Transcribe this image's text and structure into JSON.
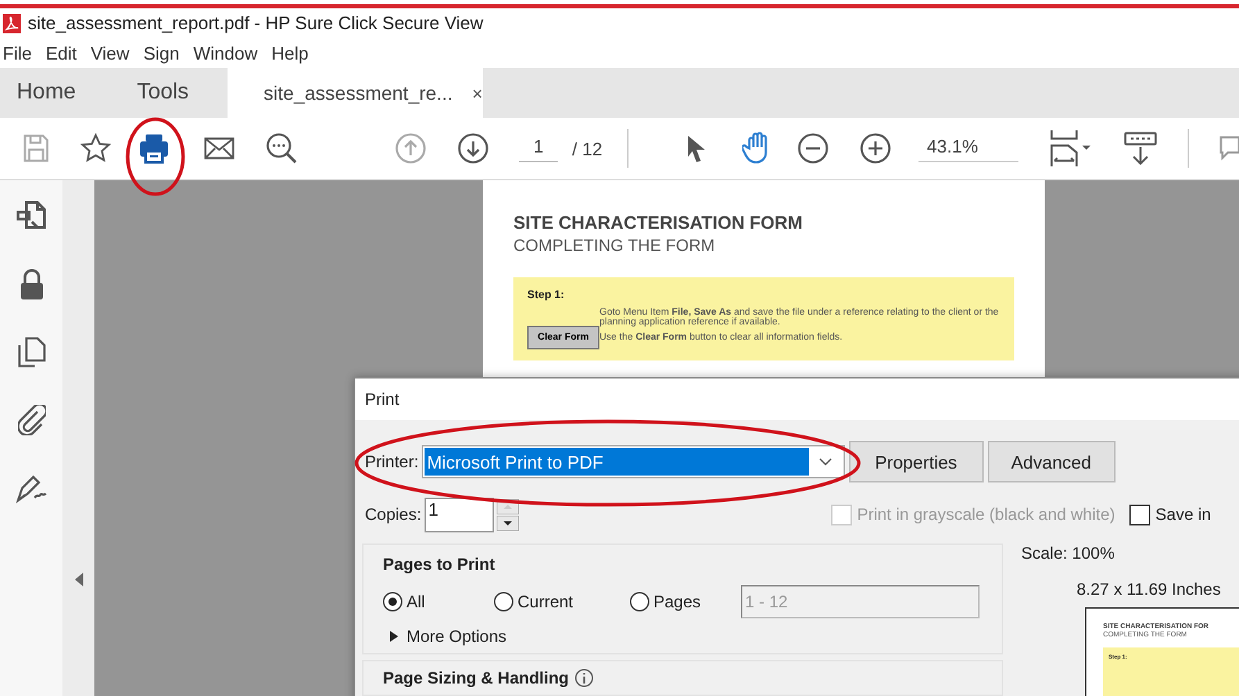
{
  "window": {
    "title": "site_assessment_report.pdf - HP Sure Click Secure View"
  },
  "menu": [
    "File",
    "Edit",
    "View",
    "Sign",
    "Window",
    "Help"
  ],
  "tabs": [
    {
      "label": "Home",
      "selected": false
    },
    {
      "label": "Tools",
      "selected": false
    },
    {
      "label": "site_assessment_re...",
      "selected": true,
      "close": "×"
    }
  ],
  "toolbar": {
    "page": "1",
    "page_total": "/ 12",
    "zoom": "43.1%",
    "tools": [
      {
        "kind": "select",
        "selected": false
      },
      {
        "kind": "hand",
        "selected": true
      }
    ]
  },
  "document": {
    "title": "SITE CHARACTERISATION FORM",
    "subtitle": "COMPLETING THE FORM",
    "step_label": "Step 1:",
    "button": "Clear Form",
    "lines": [
      "Goto Menu Item **File, Save As** and save the file under a reference relating to the client or the planning application reference if available.",
      "Use the **Clear Form** button to clear all information fields."
    ]
  },
  "print_dialog": {
    "title": "Print",
    "printer_label": "Printer:",
    "printer": "Microsoft Print to PDF",
    "buttons": [
      "Properties",
      "Advanced"
    ],
    "copies_label": "Copies:",
    "copies": "1",
    "options": [
      {
        "label": "Print in grayscale (black and white)",
        "checked": false,
        "disabled": true
      },
      {
        "label": "Save in",
        "checked": false,
        "disabled": false
      }
    ],
    "pages_to_print": {
      "title": "Pages to Print",
      "choices": [
        {
          "label": "All",
          "selected": true
        },
        {
          "label": "Current",
          "selected": false
        },
        {
          "label": "Pages",
          "selected": false
        }
      ],
      "range": "1 - 12",
      "more": "More Options"
    },
    "page_sizing": {
      "title": "Page Sizing & Handling"
    },
    "preview": {
      "scale": "Scale: 100%",
      "size": "8.27 x 11.69 Inches",
      "title": "SITE CHARACTERISATION FOR",
      "subtitle": "COMPLETING THE FORM",
      "step": "Step 1:"
    }
  }
}
